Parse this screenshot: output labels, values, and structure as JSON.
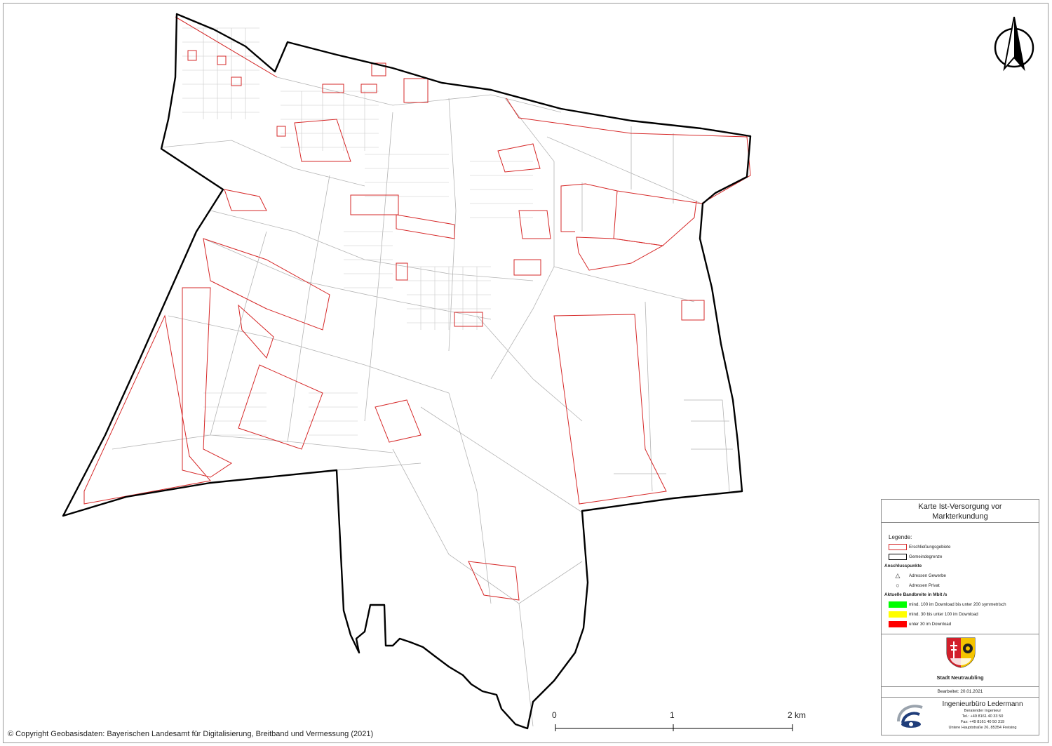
{
  "legend": {
    "title_line1": "Karte Ist-Versorgung vor",
    "title_line2": "Markterkundung",
    "heading": "Legende:",
    "items": [
      {
        "label": "Erschließungsgebiete",
        "color": "#d62828"
      },
      {
        "label": "Gemeindegrenze",
        "color": "#000000"
      }
    ],
    "anschluss_heading": "Anschlusspunkte",
    "anschluss": [
      {
        "label": "Adressen Gewerbe",
        "icon": "triangle-icon"
      },
      {
        "label": "Adressen Privat",
        "icon": "circle-icon"
      }
    ],
    "bandwidth_heading": "Aktuelle Bandbreite in Mbit /s",
    "bandwidth": [
      {
        "label": "mind. 100 im Download bis unter 200 symmetrisch",
        "color": "#00ff00"
      },
      {
        "label": "mind. 30 bis unter 100 im Download",
        "color": "#ffff00"
      },
      {
        "label": "unter 30 im Download",
        "color": "#ff0000"
      }
    ],
    "town": "Stadt Neutraubling",
    "edited": "Bearbeitet: 20.01.2021",
    "office": {
      "name": "Ingenieurbüro Ledermann",
      "line1": "Beratender Ingenieur",
      "line2": "Tel.: +49 8161 40 33 50",
      "line3": "Fax: +49 8161 40 50 319",
      "line4": "Untere Hauptstraße 26, 85354 Freising"
    }
  },
  "scale": {
    "labels": [
      "0",
      "1",
      "2 km"
    ]
  },
  "copyright": "© Copyright Geobasisdaten: Bayerischen Landesamt für Digitalisierung, Breitband und Vermessung (2021)",
  "colors": {
    "boundary": "#000000",
    "development": "#d62828",
    "parcel": "#b0b0b0"
  }
}
